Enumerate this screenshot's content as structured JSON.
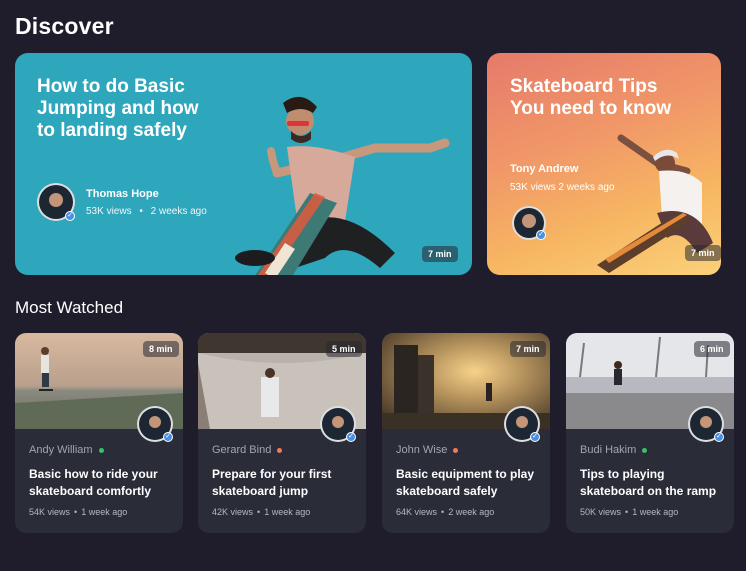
{
  "header": {
    "title": "Discover",
    "section": "Most Watched"
  },
  "featured": [
    {
      "title": "How to do Basic Jumping and how to landing safely",
      "author": "Thomas Hope",
      "views": "53K views",
      "time": "2 weeks ago",
      "duration": "7 min"
    },
    {
      "title": "Skateboard Tips You need to know",
      "author": "Tony Andrew",
      "meta": "53K views 2 weeks ago",
      "duration": "7 min"
    }
  ],
  "cards": [
    {
      "author": "Andy William",
      "status_color": "#37c26b",
      "title": "Basic how to ride your skateboard comfortly",
      "views": "54K views",
      "time": "1 week ago",
      "duration": "8 min"
    },
    {
      "author": "Gerard Bind",
      "status_color": "#f07a5c",
      "title": "Prepare for your first skateboard jump",
      "views": "42K views",
      "time": "1 week ago",
      "duration": "5 min"
    },
    {
      "author": "John Wise",
      "status_color": "#f07a5c",
      "title": "Basic equipment to play skateboard safely",
      "views": "64K views",
      "time": "2 week ago",
      "duration": "7 min"
    },
    {
      "author": "Budi Hakim",
      "status_color": "#37c26b",
      "title": "Tips to playing skateboard on the ramp",
      "views": "50K views",
      "time": "1 week ago",
      "duration": "6 min"
    }
  ],
  "icons": {
    "verified": "check-badge-icon"
  }
}
